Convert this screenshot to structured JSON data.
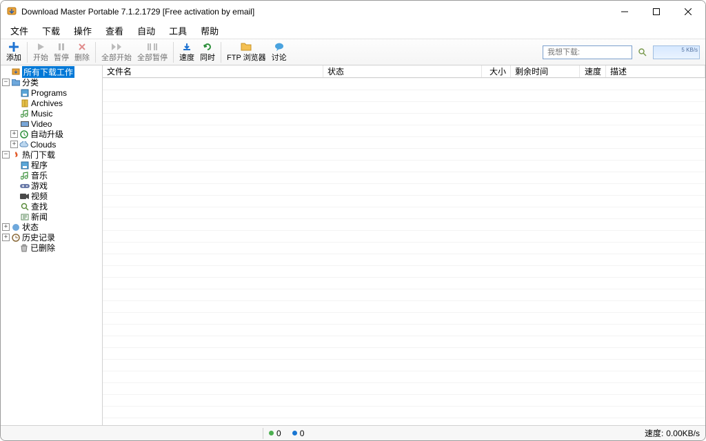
{
  "window": {
    "title": "Download Master Portable 7.1.2.1729 [Free activation by email]"
  },
  "menu": {
    "file": "文件",
    "download": "下载",
    "action": "操作",
    "view": "查看",
    "auto": "自动",
    "tools": "工具",
    "help": "帮助"
  },
  "toolbar": {
    "add": "添加",
    "start": "开始",
    "pause": "暂停",
    "delete": "删除",
    "start_all": "全部开始",
    "pause_all": "全部暂停",
    "speed": "速度",
    "simultaneous": "同时",
    "ftp_browser": "FTP 浏览器",
    "discuss": "讨论",
    "search_placeholder": "我想下载:",
    "graph_label": "5 KB/s"
  },
  "tree": {
    "all_jobs": "所有下载工作",
    "categories": "分类",
    "cat_programs": "Programs",
    "cat_archives": "Archives",
    "cat_music": "Music",
    "cat_video": "Video",
    "auto_update": "自动升级",
    "clouds": "Clouds",
    "popular": "热门下载",
    "pop_programs": "程序",
    "pop_music": "音乐",
    "pop_games": "游戏",
    "pop_video": "视频",
    "pop_search": "查找",
    "pop_news": "新闻",
    "status": "状态",
    "history": "历史记录",
    "deleted": "已删除"
  },
  "columns": {
    "filename": "文件名",
    "state": "状态",
    "size": "大小",
    "time_left": "剩余时间",
    "speed": "速度",
    "desc": "描述"
  },
  "status": {
    "green": "0",
    "blue": "0",
    "speed_label": "速度:",
    "speed_value": "0.00KB/s"
  }
}
